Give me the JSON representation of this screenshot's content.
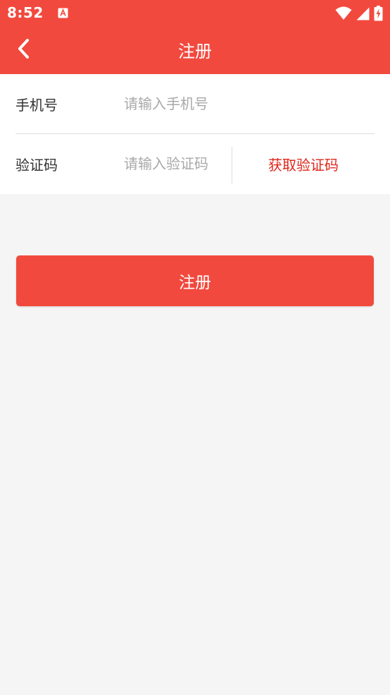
{
  "status_bar": {
    "time": "8:52",
    "icons": [
      "notification-a-icon",
      "wifi-icon",
      "signal-icon",
      "battery-charging-icon"
    ]
  },
  "header": {
    "title": "注册",
    "back_icon": "chevron-left-icon"
  },
  "form": {
    "phone": {
      "label": "手机号",
      "placeholder": "请输入手机号",
      "value": ""
    },
    "code": {
      "label": "验证码",
      "placeholder": "请输入验证码",
      "value": "",
      "get_code_label": "获取验证码"
    }
  },
  "submit": {
    "label": "注册"
  },
  "colors": {
    "primary": "#f2493e",
    "accent_text": "#e0261a",
    "background": "#f5f5f5",
    "placeholder": "#a8a8a8"
  }
}
